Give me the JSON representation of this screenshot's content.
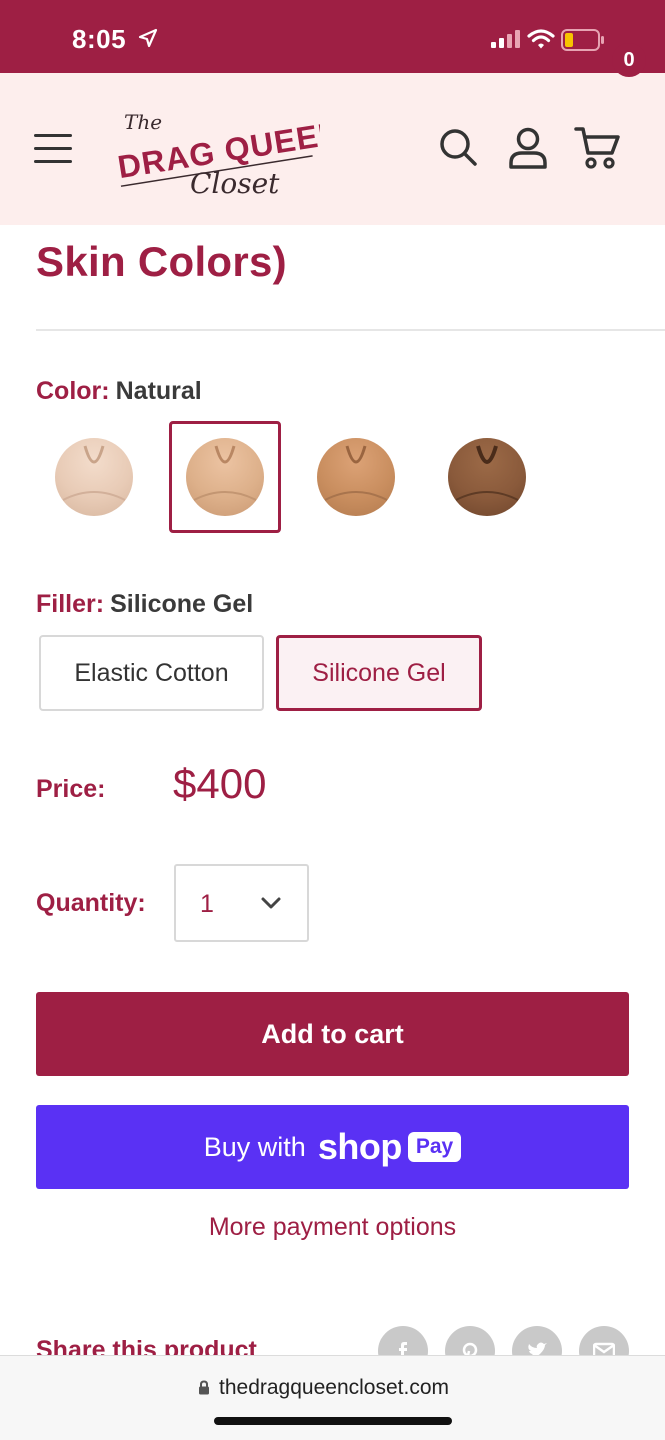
{
  "status_bar": {
    "time": "8:05"
  },
  "header": {
    "logo_text": {
      "the": "The",
      "main": "DRAG QUEEN",
      "sub": "Closet"
    },
    "cart_count": "0"
  },
  "product": {
    "title_fragment": "Skin Colors)",
    "color": {
      "label": "Color:",
      "value": "Natural",
      "swatches": [
        {
          "name": "light",
          "tone": "#e8cbb6",
          "selected": false
        },
        {
          "name": "natural",
          "tone": "#ddb08a",
          "selected": true
        },
        {
          "name": "tan",
          "tone": "#c98e5f",
          "selected": false
        },
        {
          "name": "dark",
          "tone": "#8a5a3b",
          "selected": false
        }
      ]
    },
    "filler": {
      "label": "Filler:",
      "value": "Silicone Gel",
      "options": [
        {
          "label": "Elastic Cotton",
          "selected": false
        },
        {
          "label": "Silicone Gel",
          "selected": true
        }
      ]
    },
    "price": {
      "label": "Price:",
      "value": "$400"
    },
    "quantity": {
      "label": "Quantity:",
      "value": "1"
    }
  },
  "actions": {
    "add_to_cart": "Add to cart",
    "shop_pay": {
      "prefix": "Buy with",
      "shop": "shop",
      "pay": "Pay"
    },
    "more_payment": "More payment options"
  },
  "share": {
    "label": "Share this product",
    "icons": [
      "facebook-icon",
      "pinterest-icon",
      "twitter-icon",
      "email-icon"
    ]
  },
  "browser": {
    "url": "thedragqueencloset.com"
  },
  "colors": {
    "brand": "#9e1f44",
    "header_bg": "#fdeeed",
    "shop_pay": "#5a31f4"
  }
}
